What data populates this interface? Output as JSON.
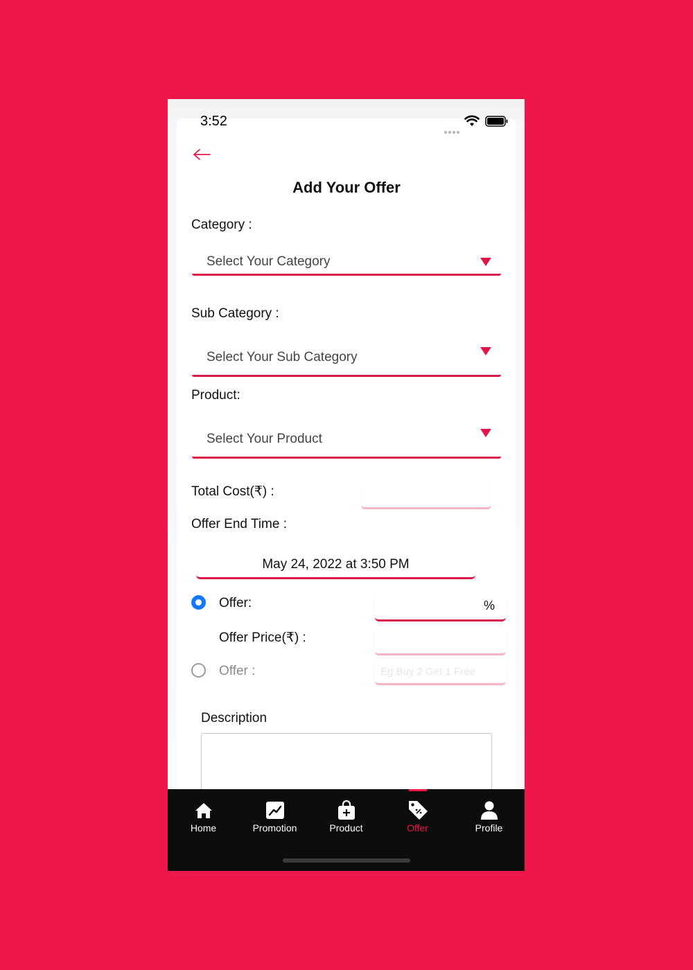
{
  "status_bar": {
    "time": "3:52",
    "icons": [
      "signal-dots-icon",
      "wifi-icon",
      "battery-icon"
    ]
  },
  "header": {
    "back_icon": "arrow-left-icon",
    "title": "Add Your Offer"
  },
  "form": {
    "category": {
      "label": "Category :",
      "placeholder": "Select Your Category"
    },
    "sub_category": {
      "label": "Sub Category :",
      "placeholder": "Select Your Sub Category"
    },
    "product": {
      "label": "Product:",
      "placeholder": "Select Your Product"
    },
    "total_cost": {
      "label": "Total Cost(₹) :",
      "value": ""
    },
    "offer_end_time": {
      "label": "Offer End Time :",
      "value": "May 24, 2022 at 3:50 PM"
    },
    "offer_percent": {
      "label": "Offer:",
      "unit": "%",
      "selected": true
    },
    "offer_price": {
      "label": "Offer Price(₹) :",
      "value": ""
    },
    "offer_text": {
      "label": "Offer :",
      "placeholder": "Eg Buy 2 Get 1 Free",
      "selected": false
    },
    "description": {
      "label": "Description",
      "value": ""
    }
  },
  "tabbar": {
    "items": [
      {
        "label": "Home",
        "icon": "home-icon"
      },
      {
        "label": "Promotion",
        "icon": "trending-chart-icon"
      },
      {
        "label": "Product",
        "icon": "shopping-bag-plus-icon"
      },
      {
        "label": "Offer",
        "icon": "discount-tag-icon",
        "active": true
      },
      {
        "label": "Profile",
        "icon": "person-icon"
      }
    ]
  },
  "colors": {
    "accent": "#ED174B",
    "background": "#ED174B",
    "radio_selected": "#1479FF",
    "tabbar": "#0d0d0d"
  }
}
